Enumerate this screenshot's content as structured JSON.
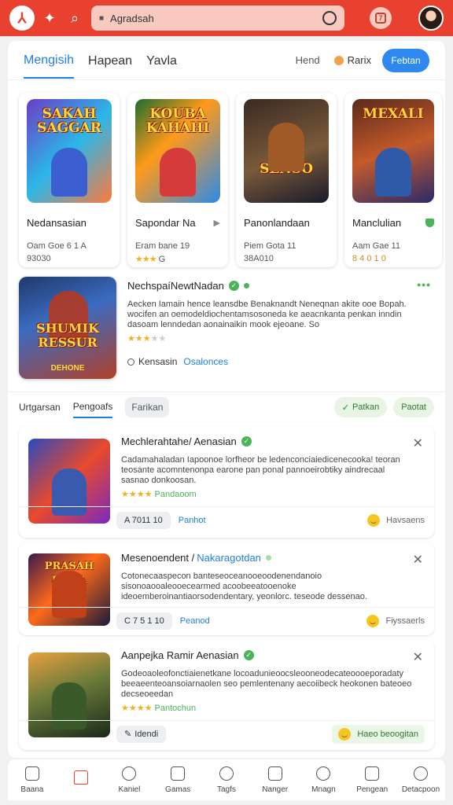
{
  "topbar": {
    "url": "Agradsah",
    "calendar_day": "7"
  },
  "tabs": {
    "items": [
      "Mengisih",
      "Hapean",
      "Yavla"
    ],
    "side_link": "Hend",
    "rank_label": "Rarix",
    "action_label": "Febtan"
  },
  "games": [
    {
      "thumb_title": "SAKAH SAGGAR",
      "name": "Nedansasian",
      "tag": "",
      "meta": "Oam Goe 6 1 A",
      "stars_prefix": "",
      "stars_text": "93030"
    },
    {
      "thumb_title": "KOUBA KAHAHI",
      "name": "Sapondar Na",
      "tag": "▶",
      "meta": "Eram bane 19",
      "stars_prefix": "★★★",
      "stars_text": "G"
    },
    {
      "thumb_title": "SENSO",
      "name": "Panonlandaan",
      "tag": "",
      "meta": "Piem Gota 11",
      "stars_prefix": "",
      "stars_text": "38A010"
    },
    {
      "thumb_title": "MEXALI",
      "name": "Manclulian",
      "tag": "",
      "meta": "Aam Gae 11",
      "stars_prefix": "",
      "stars_text": "8 4 0 1 0"
    }
  ],
  "featured": {
    "thumb_title": "SHUMIK RESSUR",
    "thumb_sub": "DEHONE",
    "title": "NechspaíNewtNadan",
    "description": "Aecken Iamain hence leansdbe Benaknandt Neneqnan akite ooe Bopah. wocifen an oemodeldiochentamsosoneda ke aeacnkanta penkan inndin dasoam lenndedan aonainaikin mook ejeoane. So",
    "stars_text": "",
    "link_1": "Kensasin",
    "link_2": "Osalonces"
  },
  "subtabs": {
    "items": [
      "Urtgarsan",
      "Pengoafs",
      "Farikan"
    ],
    "pill_1": "Patkan",
    "pill_2": "Paotat"
  },
  "list": [
    {
      "thumb_title": "",
      "title": "Mechlerahtahe/ Aenasian",
      "title_link": "",
      "description": "Cadamahaladan Iapoonoe lorfheor be ledenconciaiedicenecooka! teoran teosante acomntenonpa earone pan ponal pannoeirobtiky aindrecaal sasnao donkoosan.",
      "stars": "★★★★",
      "stars_text": "Pandaoom",
      "chip": "A 7011 10",
      "link": "Panhot",
      "right": "Havsaens"
    },
    {
      "thumb_title": "PRASAH KUHA",
      "title": "Mesenoendent /",
      "title_link": "Nakaragotdan",
      "description": "Cotonecaaspecon banteseoceanooeoodenendanoio sisonoaooaleooecearmed acoobeeatooenoke ideoemberoinantiaorsodendentary, yeonlorc. teseode dessenao.",
      "stars": "",
      "stars_text": "",
      "chip": "C 7 5 1 10",
      "link": "Peanod",
      "right": "Fiyssaerls"
    },
    {
      "thumb_title": "",
      "title": "Aanpejka Ramir Aenasian",
      "title_link": "",
      "description": "Godeoaoleofonctiaienetkane locoadunieoocsleooneodecateoooeporadaty beeaeenteoansoiarnaolen seo pemlentenany aecoiibeck heokonen bateoeo decseoeedan",
      "stars": "★★★★",
      "stars_text": "Pantochun",
      "chip": "Idendi",
      "link": "",
      "right": "Haeo beoogitan"
    }
  ],
  "bottom_nav": [
    "Baana",
    "",
    "Kaniel",
    "Gamas",
    "Tagfs",
    "Nanger",
    "Mnagn",
    "Pengean",
    "Detacpoon"
  ],
  "colors": {
    "accent": "#e8412f",
    "link": "#1f7ee6",
    "verified": "#4bb45a",
    "star": "#f0b020"
  }
}
